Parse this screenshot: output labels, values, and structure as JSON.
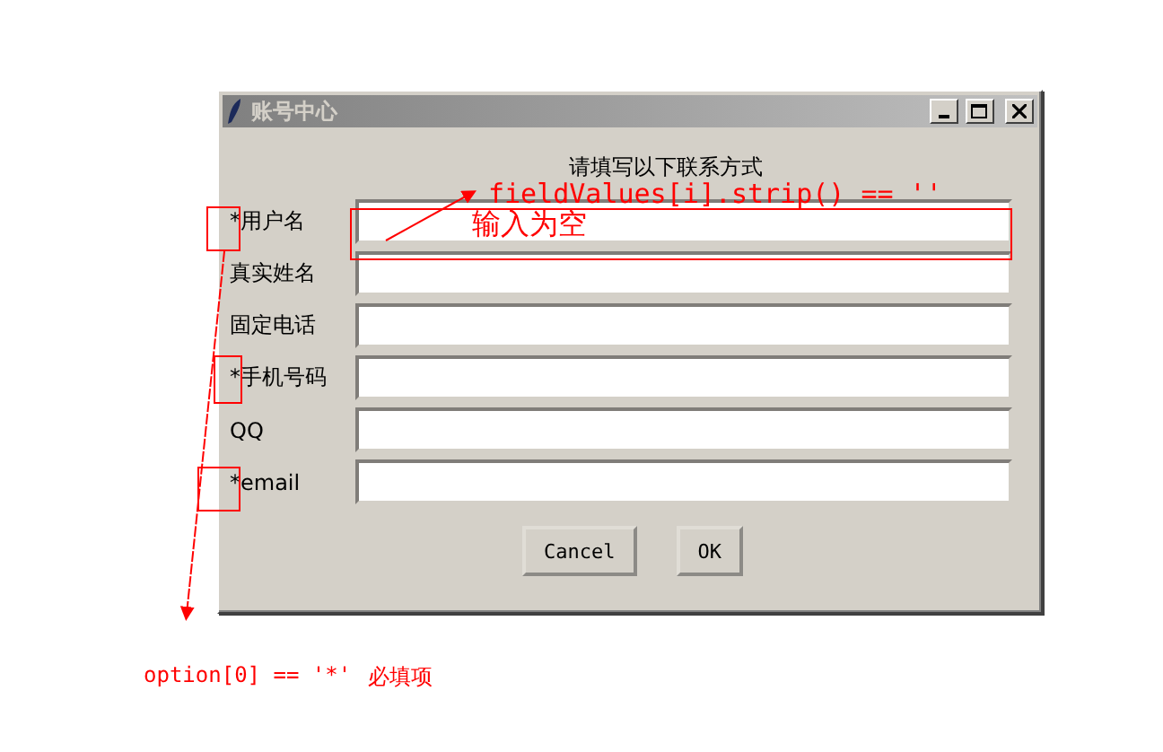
{
  "window": {
    "title": "账号中心"
  },
  "heading": "请填写以下联系方式",
  "fields": [
    {
      "label": "*用户名"
    },
    {
      "label": "真实姓名"
    },
    {
      "label": "固定电话"
    },
    {
      "label": "*手机号码"
    },
    {
      "label": "QQ"
    },
    {
      "label": "*email"
    }
  ],
  "buttons": [
    "Cancel",
    "OK"
  ],
  "annotations": [
    {
      "text": "fieldValues[i].strip() == ''"
    },
    {
      "text": "输入为空"
    },
    {
      "text": "option[0] == '*'"
    },
    {
      "text": "必填项"
    }
  ]
}
